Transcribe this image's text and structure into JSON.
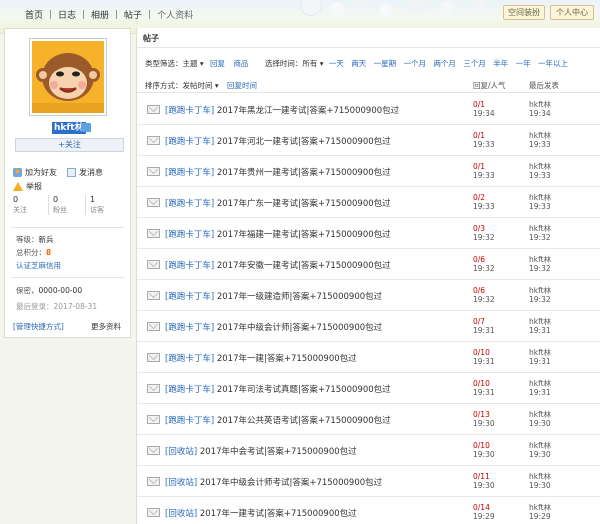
{
  "nav": {
    "items": [
      "首页",
      "日志",
      "相册",
      "帖子",
      "个人资料"
    ],
    "space_decor": "空间装扮",
    "personal_center": "个人中心"
  },
  "profile": {
    "username": "hkft林",
    "follow": "+关注",
    "add_friend": "加为好友",
    "send_message": "发消息",
    "report": "举报",
    "stats": [
      {
        "value": "0",
        "label": "关注"
      },
      {
        "value": "0",
        "label": "粉丝"
      },
      {
        "value": "1",
        "label": "访客"
      }
    ],
    "level_label": "等级：",
    "level_value": "新兵",
    "points_label": "总积分：",
    "points_value": "8",
    "verify": "认证芝麻信用",
    "secret_label": "保密，",
    "secret_value": "0000-00-00",
    "last_login_label": "最后登录：",
    "last_login_value": "2017-08-31",
    "manage_shortcuts": "[管理快捷方式]",
    "more_info": "更多资料"
  },
  "main": {
    "title": "帖子",
    "filter_type_label": "类型筛选：",
    "filter_type_value": "主题",
    "filter_type_opts": [
      "回复",
      "商品"
    ],
    "filter_time_label": "选择时间：",
    "filter_time_value": "所有",
    "filter_time_opts": [
      "一天",
      "两天",
      "一星期",
      "一个月",
      "两个月",
      "三个月",
      "半年",
      "一年",
      "一年以上"
    ],
    "sort_label": "排序方式：",
    "sort_value": "发帖时间",
    "sort_alt": "回复时间",
    "col_reply": "回复/人气",
    "col_last": "最后发表"
  },
  "posts": [
    {
      "tag": "[跑跑卡丁车]",
      "title": "2017年黑龙江一建考试|答案+715000900包过",
      "replies": "0/1",
      "rtime": "19:34",
      "author": "hkft林",
      "atime": "19:34"
    },
    {
      "tag": "[跑跑卡丁车]",
      "title": "2017年河北一建考试|答案+715000900包过",
      "replies": "0/1",
      "rtime": "19:33",
      "author": "hkft林",
      "atime": "19:33"
    },
    {
      "tag": "[跑跑卡丁车]",
      "title": "2017年贵州一建考试|答案+715000900包过",
      "replies": "0/1",
      "rtime": "19:33",
      "author": "hkft林",
      "atime": "19:33"
    },
    {
      "tag": "[跑跑卡丁车]",
      "title": "2017年广东一建考试|答案+715000900包过",
      "replies": "0/2",
      "rtime": "19:33",
      "author": "hkft林",
      "atime": "19:33"
    },
    {
      "tag": "[跑跑卡丁车]",
      "title": "2017年福建一建考试|答案+715000900包过",
      "replies": "0/3",
      "rtime": "19:32",
      "author": "hkft林",
      "atime": "19:32"
    },
    {
      "tag": "[跑跑卡丁车]",
      "title": "2017年安徽一建考试|答案+715000900包过",
      "replies": "0/6",
      "rtime": "19:32",
      "author": "hkft林",
      "atime": "19:32"
    },
    {
      "tag": "[跑跑卡丁车]",
      "title": "2017年一级建造师|答案+715000900包过",
      "replies": "0/6",
      "rtime": "19:32",
      "author": "hkft林",
      "atime": "19:32"
    },
    {
      "tag": "[跑跑卡丁车]",
      "title": "2017年中级会计师|答案+715000900包过",
      "replies": "0/7",
      "rtime": "19:31",
      "author": "hkft林",
      "atime": "19:31"
    },
    {
      "tag": "[跑跑卡丁车]",
      "title": "2017年一建|答案+715000900包过",
      "replies": "0/10",
      "rtime": "19:31",
      "author": "hkft林",
      "atime": "19:31"
    },
    {
      "tag": "[跑跑卡丁车]",
      "title": "2017年司法考试真题|答案+715000900包过",
      "replies": "0/10",
      "rtime": "19:31",
      "author": "hkft林",
      "atime": "19:31"
    },
    {
      "tag": "[跑跑卡丁车]",
      "title": "2017年公共英语考试|答案+715000900包过",
      "replies": "0/13",
      "rtime": "19:30",
      "author": "hkft林",
      "atime": "19:30"
    },
    {
      "tag": "[回收站]",
      "title": "2017年中会考试|答案+715000900包过",
      "replies": "0/10",
      "rtime": "19:30",
      "author": "hkft林",
      "atime": "19:30"
    },
    {
      "tag": "[回收站]",
      "title": "2017年中级会计师考试|答案+715000900包过",
      "replies": "0/11",
      "rtime": "19:30",
      "author": "hkft林",
      "atime": "19:30"
    },
    {
      "tag": "[回收站]",
      "title": "2017年一建考试|答案+715000900包过",
      "replies": "0/14",
      "rtime": "19:29",
      "author": "hkft林",
      "atime": "19:29"
    }
  ]
}
